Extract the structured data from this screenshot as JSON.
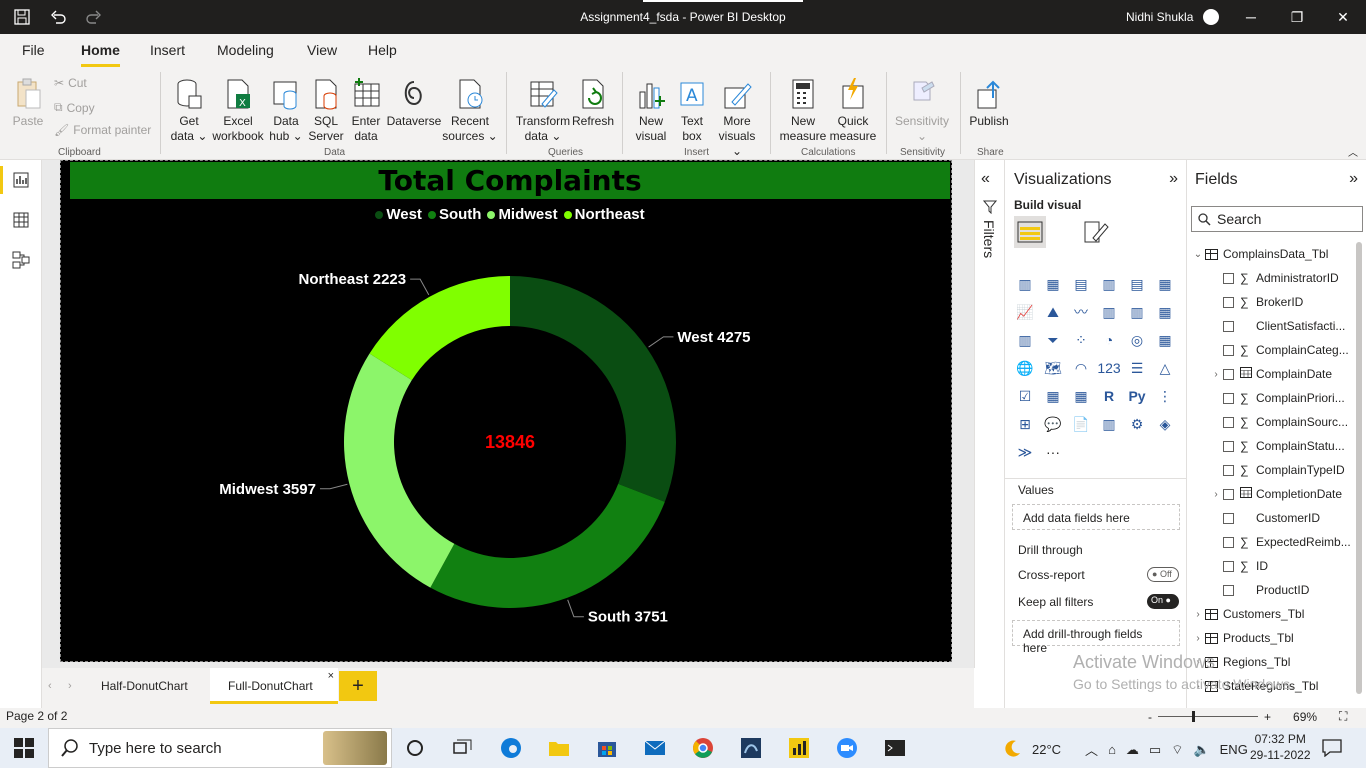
{
  "window": {
    "title": "Assignment4_fsda - Power BI Desktop",
    "user": "Nidhi Shukla"
  },
  "menu_tabs": [
    "File",
    "Home",
    "Insert",
    "Modeling",
    "View",
    "Help"
  ],
  "ribbon": {
    "clipboard": {
      "paste": "Paste",
      "cut": "Cut",
      "copy": "Copy",
      "format_painter": "Format painter",
      "label": "Clipboard"
    },
    "data": {
      "get_data": [
        "Get",
        "data ⌄"
      ],
      "excel": [
        "Excel",
        "workbook"
      ],
      "data_hub": [
        "Data",
        "hub ⌄"
      ],
      "sql": [
        "SQL",
        "Server"
      ],
      "enter_data": [
        "Enter",
        "data"
      ],
      "dataverse": [
        "Dataverse",
        ""
      ],
      "recent": [
        "Recent",
        "sources ⌄"
      ],
      "label": "Data"
    },
    "queries": {
      "transform": [
        "Transform",
        "data ⌄"
      ],
      "refresh": [
        "Refresh",
        ""
      ],
      "label": "Queries"
    },
    "insert": {
      "new_visual": [
        "New",
        "visual"
      ],
      "text_box": [
        "Text",
        "box"
      ],
      "more_visuals": [
        "More",
        "visuals ⌄"
      ],
      "label": "Insert"
    },
    "calculations": {
      "new_measure": [
        "New",
        "measure"
      ],
      "quick_measure": [
        "Quick",
        "measure"
      ],
      "label": "Calculations"
    },
    "sensitivity": {
      "btn": [
        "Sensitivity",
        "⌄"
      ],
      "label": "Sensitivity"
    },
    "share": {
      "publish": [
        "Publish",
        ""
      ],
      "label": "Share"
    }
  },
  "chart_data": {
    "type": "pie",
    "donut": true,
    "title": "Total Complaints",
    "center_label": "13846",
    "legend_position": "top-center",
    "categories": [
      "West",
      "South",
      "Midwest",
      "Northeast"
    ],
    "values": [
      4275,
      3751,
      3597,
      2223
    ],
    "colors": [
      "#0a4d12",
      "#118011",
      "#8cf56a",
      "#80ff00"
    ],
    "data_labels": [
      "West 4275",
      "South 3751",
      "Midwest 3597",
      "Northeast 2223"
    ],
    "center_color": "#ff0000"
  },
  "filters_label": "Filters",
  "visualizations": {
    "title": "Visualizations",
    "build_visual": "Build visual",
    "values_label": "Values",
    "values_placeholder": "Add data fields here",
    "drill_through": "Drill through",
    "cross_report": "Cross-report",
    "cross_report_state": "Off",
    "keep_filters": "Keep all filters",
    "keep_filters_state": "On",
    "drill_placeholder": "Add drill-through fields here",
    "more": "···"
  },
  "fields": {
    "title": "Fields",
    "search_placeholder": "Search",
    "tables": [
      {
        "name": "ComplainsData_Tbl",
        "expanded": true,
        "fields": [
          {
            "name": "AdministratorID",
            "sigma": true,
            "date": false,
            "expand": false
          },
          {
            "name": "BrokerID",
            "sigma": true,
            "date": false,
            "expand": false
          },
          {
            "name": "ClientSatisfacti...",
            "sigma": false,
            "date": false,
            "expand": false
          },
          {
            "name": "ComplainCateg...",
            "sigma": true,
            "date": false,
            "expand": false
          },
          {
            "name": "ComplainDate",
            "sigma": false,
            "date": true,
            "expand": true
          },
          {
            "name": "ComplainPriori...",
            "sigma": true,
            "date": false,
            "expand": false
          },
          {
            "name": "ComplainSourc...",
            "sigma": true,
            "date": false,
            "expand": false
          },
          {
            "name": "ComplainStatu...",
            "sigma": true,
            "date": false,
            "expand": false
          },
          {
            "name": "ComplainTypeID",
            "sigma": true,
            "date": false,
            "expand": false
          },
          {
            "name": "CompletionDate",
            "sigma": false,
            "date": true,
            "expand": true
          },
          {
            "name": "CustomerID",
            "sigma": false,
            "date": false,
            "expand": false
          },
          {
            "name": "ExpectedReimb...",
            "sigma": true,
            "date": false,
            "expand": false
          },
          {
            "name": "ID",
            "sigma": true,
            "date": false,
            "expand": false
          },
          {
            "name": "ProductID",
            "sigma": false,
            "date": false,
            "expand": false
          }
        ]
      },
      {
        "name": "Customers_Tbl",
        "expanded": false
      },
      {
        "name": "Products_Tbl",
        "expanded": false
      },
      {
        "name": "Regions_Tbl",
        "expanded": false
      },
      {
        "name": "StateRegions_Tbl",
        "expanded": false
      }
    ]
  },
  "watermark": {
    "line1": "Activate Windows",
    "line2": "Go to Settings to activate Windows."
  },
  "pages": {
    "tabs": [
      "Half-DonutChart",
      "Full-DonutChart"
    ],
    "active": 1,
    "add": "+"
  },
  "status": {
    "page": "Page 2 of 2",
    "zoom": "69%",
    "zoom_fraction": 0.34
  },
  "taskbar": {
    "search_placeholder": "Type here to search",
    "weather": "22°C",
    "lang": "ENG",
    "time": "07:32 PM",
    "date": "29-11-2022"
  }
}
